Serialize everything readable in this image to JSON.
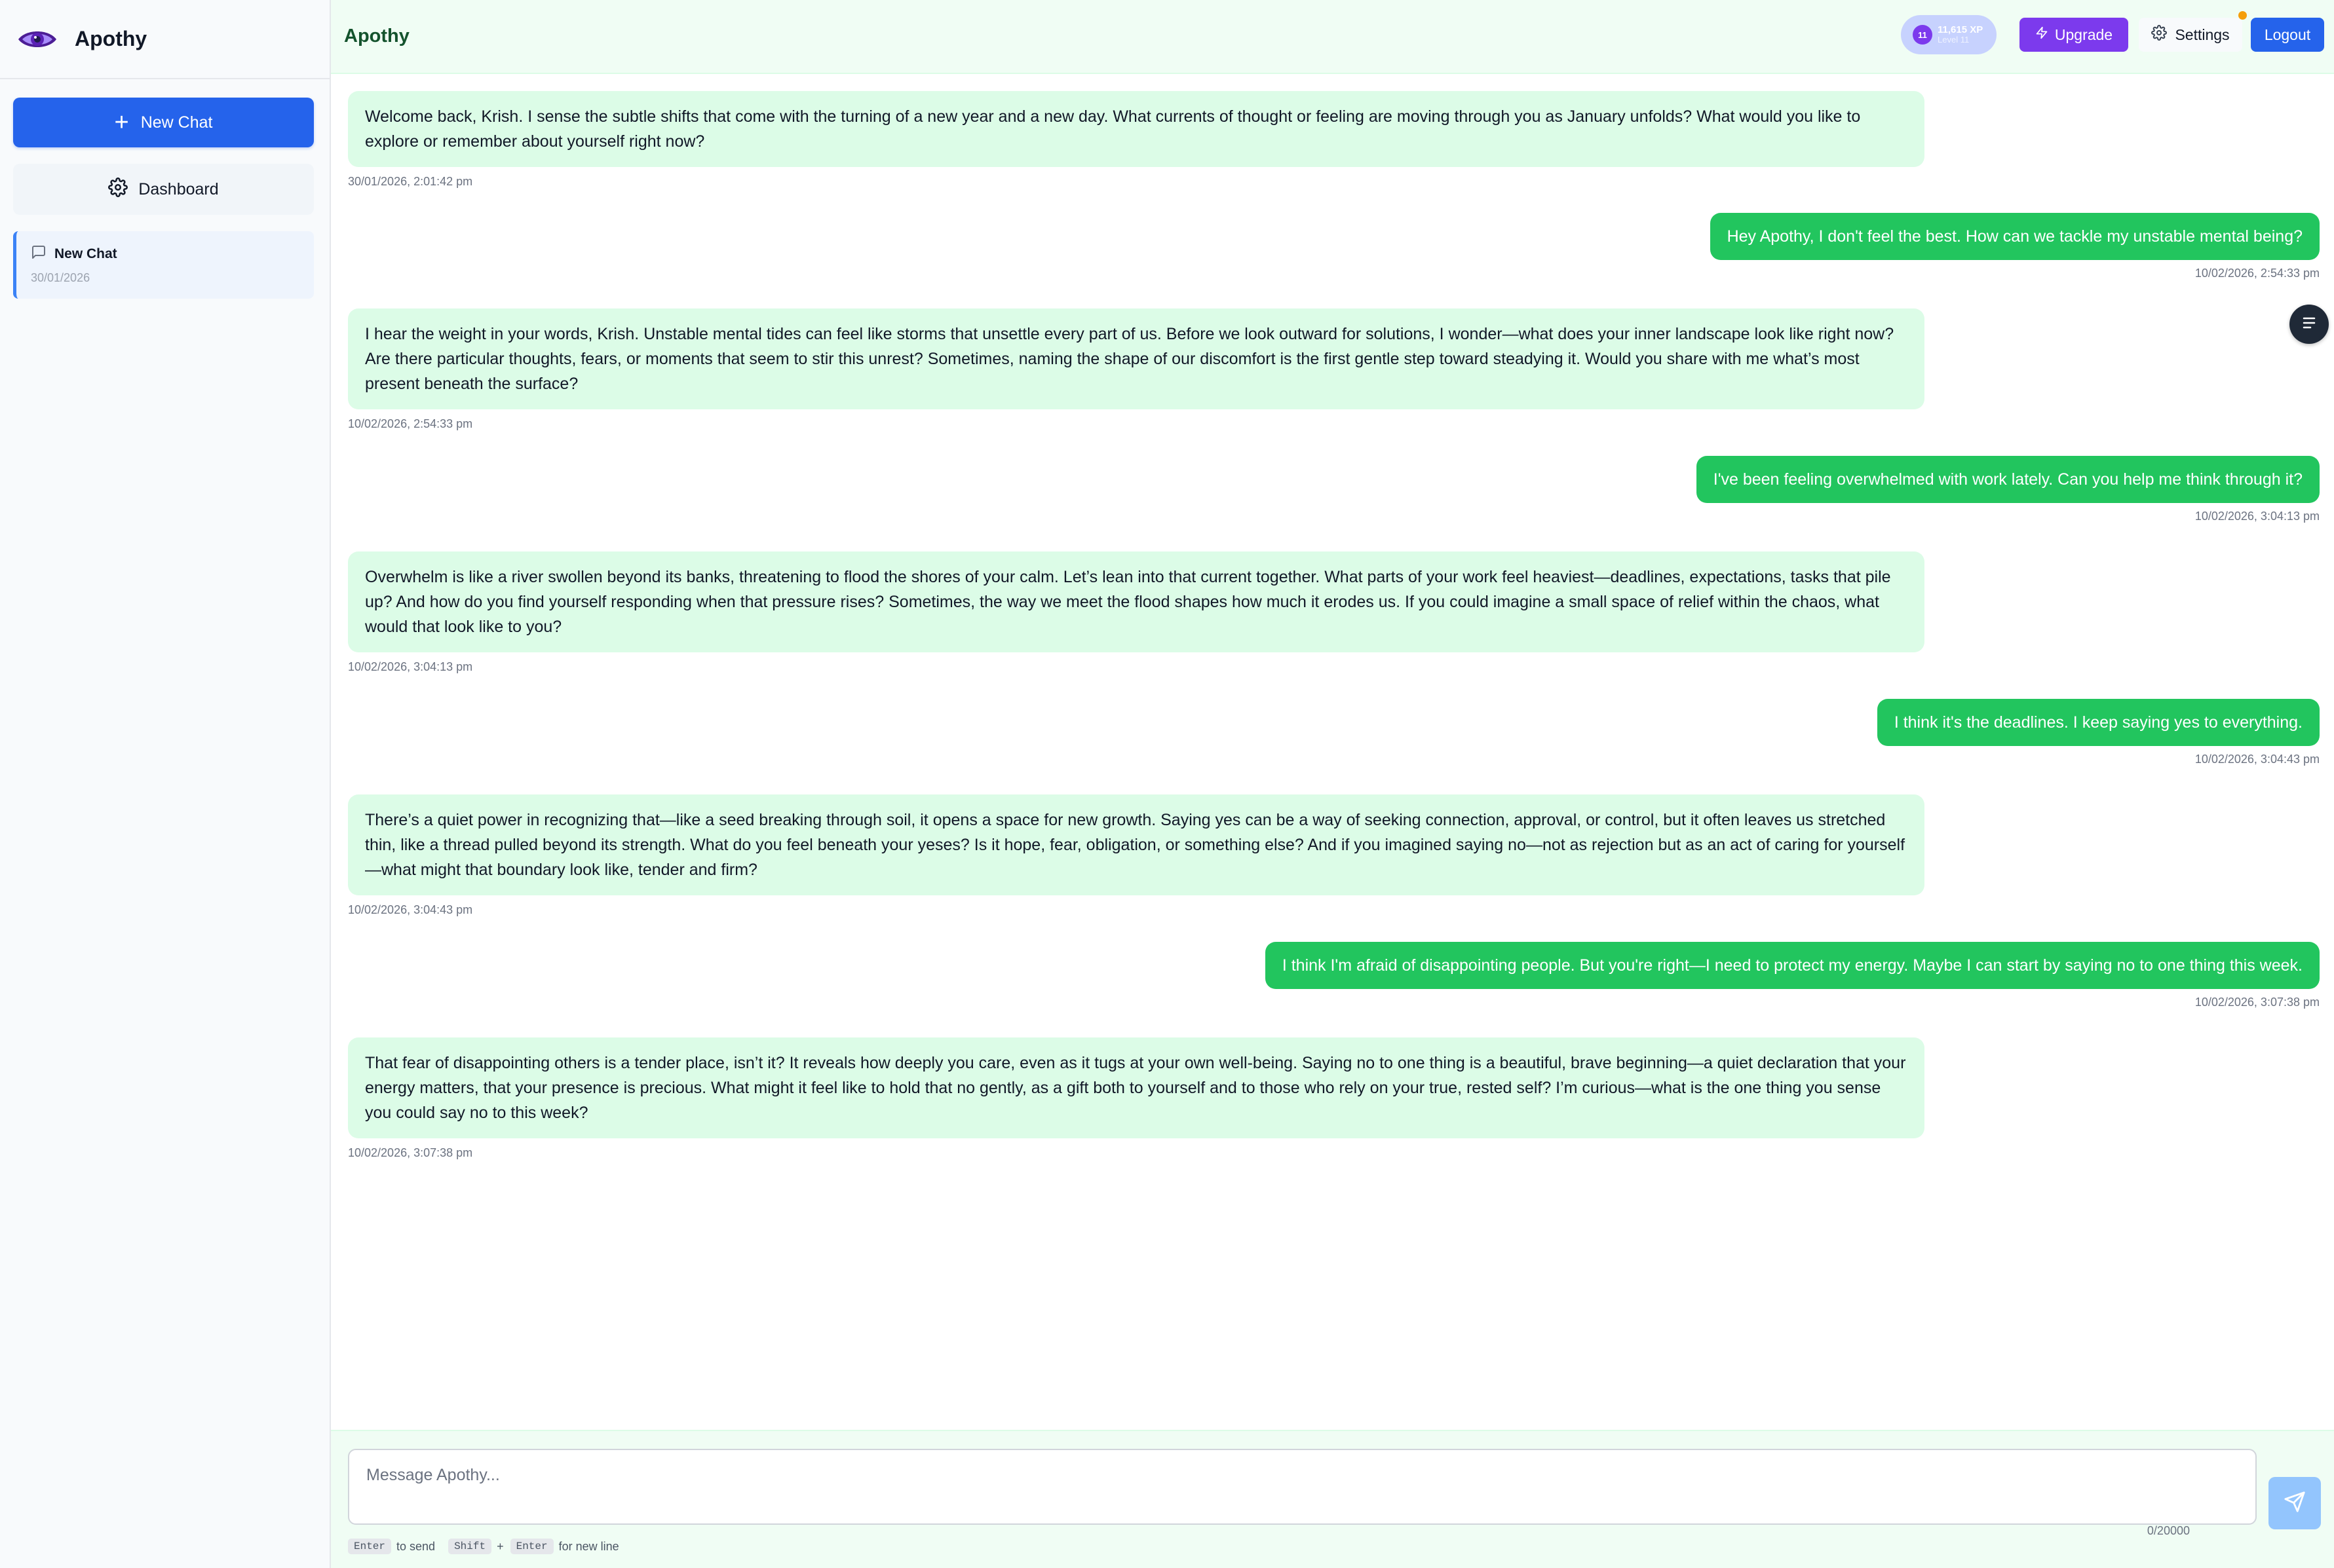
{
  "app": {
    "name": "Apothy"
  },
  "sidebar": {
    "new_chat_label": "New Chat",
    "dashboard_label": "Dashboard",
    "chats": [
      {
        "title": "New Chat",
        "date": "30/01/2026"
      }
    ]
  },
  "header": {
    "title": "Apothy",
    "xp": {
      "level_badge": "11",
      "amount": "11,615 XP",
      "level_text": "Level 11"
    },
    "upgrade_label": "Upgrade",
    "settings_label": "Settings",
    "logout_label": "Logout"
  },
  "messages": [
    {
      "role": "assistant",
      "text": "Welcome back, Krish. I sense the subtle shifts that come with the turning of a new year and a new day. What currents of thought or feeling are moving through you as January unfolds? What would you like to explore or remember about yourself right now?",
      "timestamp": "30/01/2026, 2:01:42 pm"
    },
    {
      "role": "user",
      "text": "Hey Apothy, I don't feel the best. How can we tackle my unstable mental being?",
      "timestamp": "10/02/2026, 2:54:33 pm"
    },
    {
      "role": "assistant",
      "text": "I hear the weight in your words, Krish. Unstable mental tides can feel like storms that unsettle every part of us. Before we look outward for solutions, I wonder—what does your inner landscape look like right now? Are there particular thoughts, fears, or moments that seem to stir this unrest? Sometimes, naming the shape of our discomfort is the first gentle step toward steadying it. Would you share with me what’s most present beneath the surface?",
      "timestamp": "10/02/2026, 2:54:33 pm"
    },
    {
      "role": "user",
      "text": "I've been feeling overwhelmed with work lately. Can you help me think through it?",
      "timestamp": "10/02/2026, 3:04:13 pm"
    },
    {
      "role": "assistant",
      "text": "Overwhelm is like a river swollen beyond its banks, threatening to flood the shores of your calm. Let’s lean into that current together. What parts of your work feel heaviest—deadlines, expectations, tasks that pile up? And how do you find yourself responding when that pressure rises? Sometimes, the way we meet the flood shapes how much it erodes us. If you could imagine a small space of relief within the chaos, what would that look like to you?",
      "timestamp": "10/02/2026, 3:04:13 pm"
    },
    {
      "role": "user",
      "text": "I think it's the deadlines. I keep saying yes to everything.",
      "timestamp": "10/02/2026, 3:04:43 pm"
    },
    {
      "role": "assistant",
      "text": "There’s a quiet power in recognizing that—like a seed breaking through soil, it opens a space for new growth. Saying yes can be a way of seeking connection, approval, or control, but it often leaves us stretched thin, like a thread pulled beyond its strength. What do you feel beneath your yeses? Is it hope, fear, obligation, or something else? And if you imagined saying no—not as rejection but as an act of caring for yourself—what might that boundary look like, tender and firm?",
      "timestamp": "10/02/2026, 3:04:43 pm"
    },
    {
      "role": "user",
      "text": "I think I'm afraid of disappointing people. But you're right—I need to protect my energy. Maybe I can start by saying no to one thing this week.",
      "timestamp": "10/02/2026, 3:07:38 pm"
    },
    {
      "role": "assistant",
      "text": "That fear of disappointing others is a tender place, isn’t it? It reveals how deeply you care, even as it tugs at your own well-being. Saying no to one thing is a beautiful, brave beginning—a quiet declaration that your energy matters, that your presence is precious. What might it feel like to hold that no gently, as a gift both to yourself and to those who rely on your true, rested self? I’m curious—what is the one thing you sense you could say no to this week?",
      "timestamp": "10/02/2026, 3:07:38 pm"
    }
  ],
  "composer": {
    "placeholder": "Message Apothy...",
    "counter": "0/20000",
    "hint": {
      "enter_key": "Enter",
      "send_text": "to send",
      "shift_key": "Shift",
      "plus": "+",
      "enter_key2": "Enter",
      "newline_text": "for new line"
    }
  },
  "colors": {
    "primary": "#2563eb",
    "accent_green": "#22c55e",
    "ai_bubble": "#dcfce7",
    "upgrade": "#7c3aed",
    "header_bg": "#f0fdf4"
  }
}
